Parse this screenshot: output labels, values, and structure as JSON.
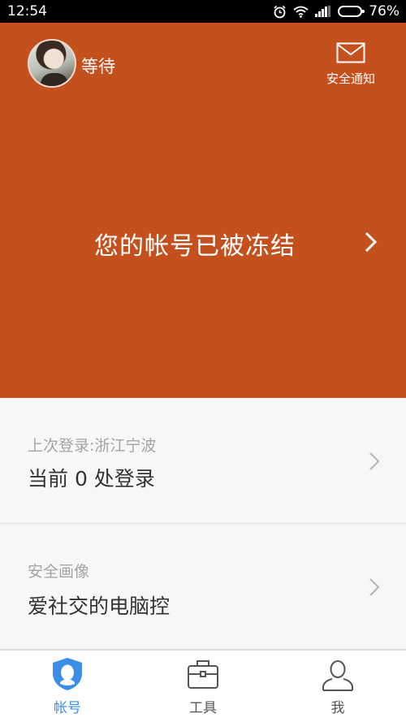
{
  "status_bar": {
    "time": "12:54",
    "battery": "76%",
    "battery_level": 0.76,
    "icons": [
      "alarm-icon",
      "wifi-icon",
      "signal-icon",
      "battery-icon"
    ]
  },
  "header": {
    "background": "#c4501e",
    "username": "等待",
    "notice_label": "安全通知",
    "frozen_message": "您的帐号已被冻结"
  },
  "cards": [
    {
      "subtitle": "上次登录:浙江宁波",
      "title": "当前 0 处登录"
    },
    {
      "subtitle": "安全画像",
      "title": "爱社交的电脑控"
    }
  ],
  "tabs": [
    {
      "label": "帐号",
      "icon": "account-shield-icon",
      "active": true
    },
    {
      "label": "工具",
      "icon": "toolbox-icon",
      "active": false
    },
    {
      "label": "我",
      "icon": "person-icon",
      "active": false
    }
  ],
  "colors": {
    "accent": "#c4501e",
    "tab_active": "#3a8ee6",
    "tab_inactive": "#555555"
  }
}
